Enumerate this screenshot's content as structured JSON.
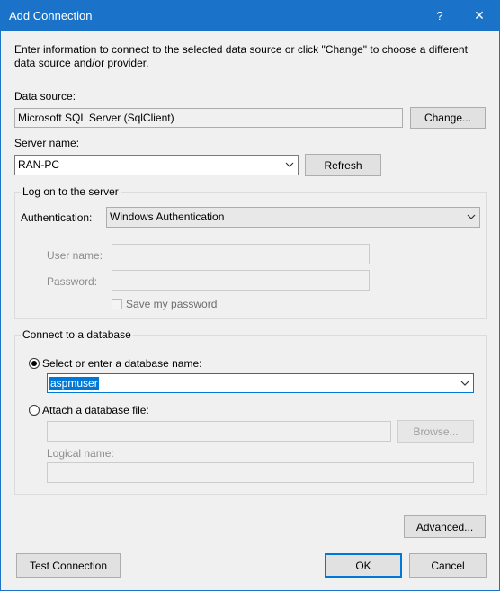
{
  "window": {
    "title": "Add Connection",
    "help_label": "?",
    "close_label": "✕"
  },
  "intro": "Enter information to connect to the selected data source or click \"Change\" to choose a different data source and/or provider.",
  "data_source": {
    "label": "Data source:",
    "value": "Microsoft SQL Server (SqlClient)",
    "change_button": "Change..."
  },
  "server": {
    "label": "Server name:",
    "value": "RAN-PC",
    "refresh_button": "Refresh"
  },
  "logon": {
    "legend": "Log on to the server",
    "auth_label": "Authentication:",
    "auth_value": "Windows Authentication",
    "username_label": "User name:",
    "username_value": "",
    "password_label": "Password:",
    "password_value": "",
    "save_password_label": "Save my password",
    "save_password_checked": false
  },
  "database": {
    "legend": "Connect to a database",
    "option_select_label": "Select or enter a database name:",
    "option_select_checked": true,
    "db_name_value": "aspmuser",
    "option_attach_label": "Attach a database file:",
    "option_attach_checked": false,
    "attach_file_value": "",
    "browse_button": "Browse...",
    "logical_name_label": "Logical name:",
    "logical_name_value": ""
  },
  "footer": {
    "advanced_button": "Advanced...",
    "test_button": "Test Connection",
    "ok_button": "OK",
    "cancel_button": "Cancel"
  },
  "colors": {
    "titlebar": "#1a73c8",
    "dialog_bg": "#f0f0f0",
    "selection": "#0078d7"
  }
}
